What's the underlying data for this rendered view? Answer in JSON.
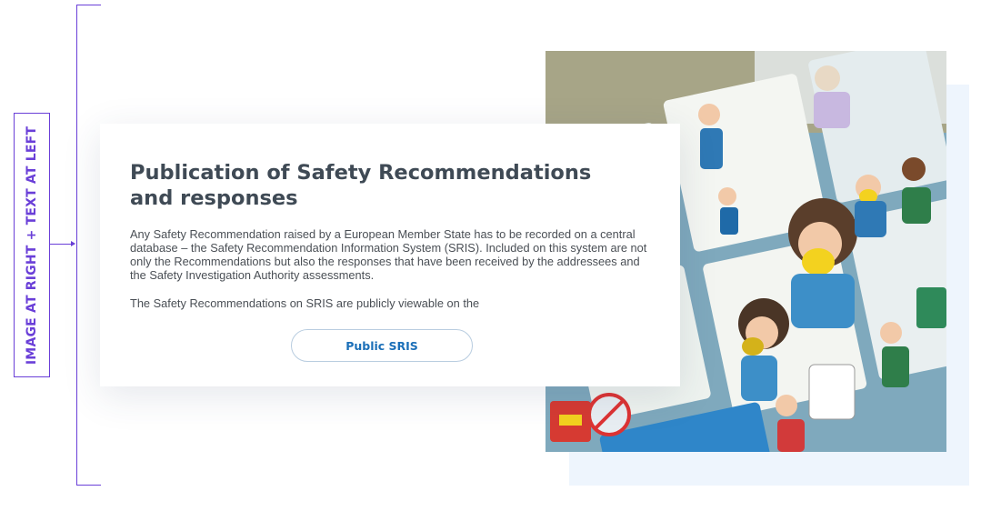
{
  "annotation": {
    "label": "IMAGE AT RIGHT + TEXT AT LEFT",
    "accent_color": "#6a3fd8"
  },
  "card": {
    "title": "Publication of Safety Recommendations and responses",
    "paragraph_1": "Any Safety Recommendation raised by a European Member State has to be recorded on a central database – the Safety Recommendation Information System (SRIS). Included on this system are not only the Recommendations but also the responses that have been received by the addressees and the Safety Investigation Authority assessments.",
    "paragraph_2": "The Safety Recommendations on SRIS are publicly viewable on the",
    "button_label": "Public SRIS"
  },
  "image": {
    "subject": "aircraft-safety-card-illustration"
  },
  "colors": {
    "title": "#3f4a55",
    "body_text": "#4a4f55",
    "button_text": "#1b6fb8",
    "bg_block": "#eef5fd"
  }
}
